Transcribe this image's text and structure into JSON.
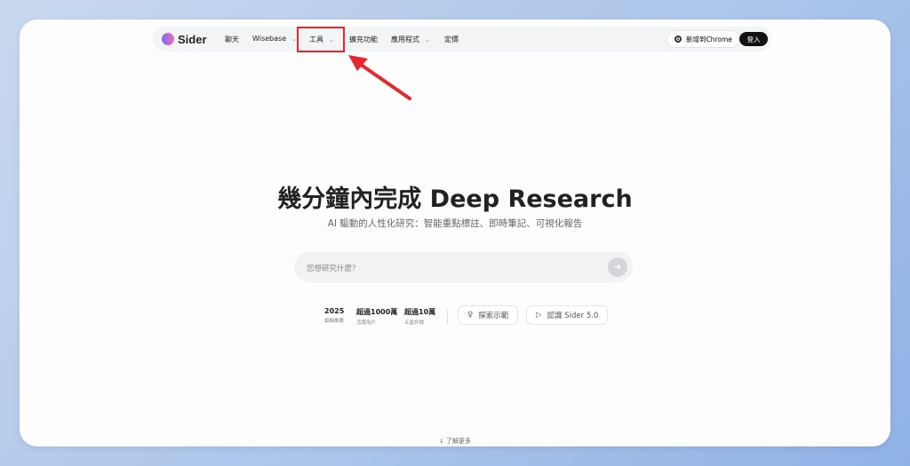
{
  "nav": {
    "brand": "Sider",
    "items": [
      {
        "label": "聊天"
      },
      {
        "label": "Wisebase"
      },
      {
        "label": "工具"
      },
      {
        "label": "擴充功能"
      },
      {
        "label": "應用程式"
      },
      {
        "label": "定價"
      }
    ],
    "chrome": "新增到Chrome",
    "login": "登入"
  },
  "hero": {
    "title": "幾分鐘內完成 Deep Research",
    "subtitle": "AI 驅動的人性化研究：智能重點標註、即時筆記、可視化報告",
    "search_placeholder": "您想研究什麼？"
  },
  "stats": [
    {
      "value": "2025",
      "label": "編輯推薦"
    },
    {
      "value": "超過1000萬",
      "label": "活躍用戶"
    },
    {
      "value": "超過10萬",
      "label": "五星評價"
    }
  ],
  "buttons": {
    "demo": "探索示範",
    "about": "認識 Sider 5.0"
  },
  "footer": {
    "more": "了解更多"
  },
  "annotation_color": "#e8262e"
}
